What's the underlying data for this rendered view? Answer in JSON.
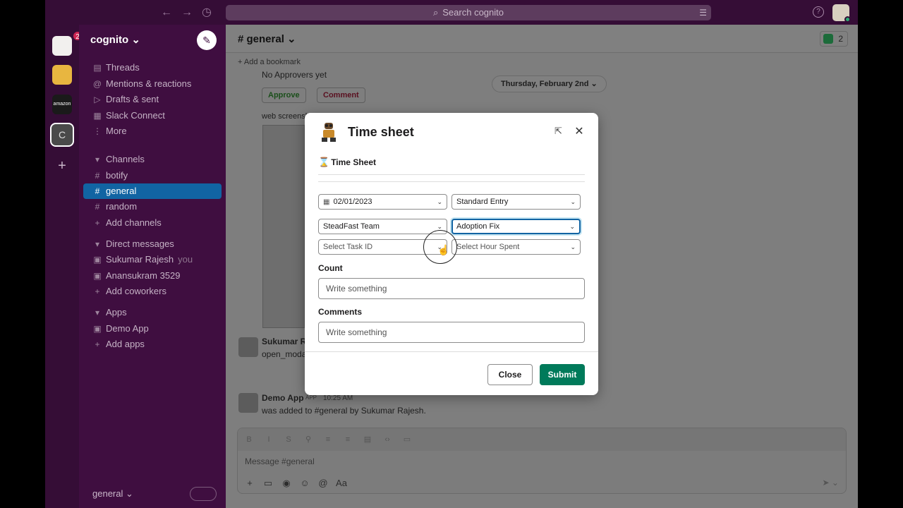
{
  "topbar": {
    "search_placeholder": "Search cognito",
    "back_icon": "arrow-left-icon",
    "forward_icon": "arrow-right-icon",
    "history_icon": "clock-icon",
    "help_glyph": "?"
  },
  "rail": {
    "badge_count": "2",
    "workspace_c_label": "C",
    "amazon_label": "amazon",
    "add_glyph": "+"
  },
  "sidebar": {
    "team_name": "cognito ⌄",
    "nav": [
      {
        "label": "Threads"
      },
      {
        "label": "Mentions & reactions"
      },
      {
        "label": "Drafts & sent"
      },
      {
        "label": "Slack Connect"
      },
      {
        "label": "More"
      }
    ],
    "channels_header": "Channels",
    "channels": [
      {
        "label": "botify"
      },
      {
        "label": "general"
      },
      {
        "label": "random"
      },
      {
        "label": "Add channels"
      }
    ],
    "dm_header": "Direct messages",
    "dms": [
      {
        "label": "Sukumar Rajesh",
        "suffix": "you"
      },
      {
        "label": "Anansukram 3529"
      },
      {
        "label": "Add coworkers"
      }
    ],
    "apps_header": "Apps",
    "apps": [
      {
        "label": "Demo App"
      },
      {
        "label": "Add apps"
      }
    ],
    "footer_channel": "general ⌄"
  },
  "channel": {
    "title": "# general ⌄",
    "member_count": "2",
    "bookmark_label": "Add a bookmark",
    "no_approvers": "No Approvers yet",
    "approve_label": "Approve",
    "comment_label": "Comment",
    "screenshot_caption": "web screensh",
    "date_divider": "Thursday, February 2nd ⌄",
    "sender_partial": "Sukumar Ra",
    "command_partial": "open_moda",
    "demo_sender": "Demo App",
    "app_tag": "APP",
    "demo_time": "10:25 AM",
    "demo_text": "was added to #general by Sukumar Rajesh.",
    "composer_placeholder": "Message #general"
  },
  "modal": {
    "title": "Time sheet",
    "section_title": "Time Sheet",
    "date_value": "02/01/2023",
    "entry_type": "Standard Entry",
    "team": "SteadFast Team",
    "project": "Adoption Fix",
    "task_placeholder": "Select Task ID",
    "hour_placeholder": "Select Hour Spent",
    "count_label": "Count",
    "count_placeholder": "Write something",
    "comments_label": "Comments",
    "comments_placeholder": "Write something",
    "close_label": "Close",
    "submit_label": "Submit"
  },
  "colors": {
    "sidebar_bg": "#3f0e40",
    "active_channel": "#1164a3",
    "submit_green": "#007a5a",
    "focus_blue": "#1264a3"
  }
}
